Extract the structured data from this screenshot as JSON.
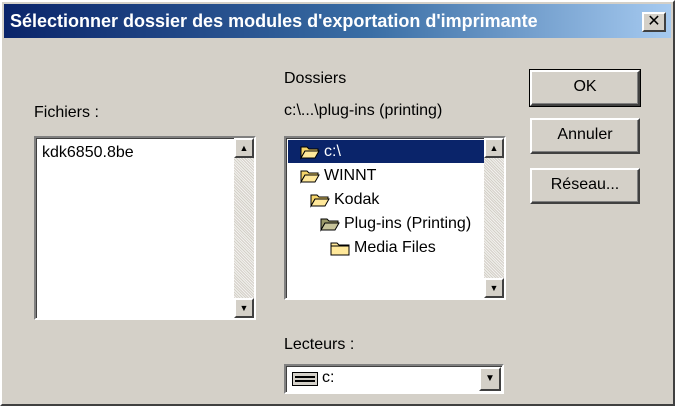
{
  "dialog": {
    "title": "Sélectionner dossier des modules d'exportation d'imprimante",
    "close_glyph": "✕"
  },
  "files": {
    "label": "Fichiers :",
    "items": [
      "kdk6850.8be"
    ]
  },
  "folders": {
    "label": "Dossiers",
    "current_path": "c:\\...\\plug-ins (printing)",
    "items": [
      {
        "label": "c:\\",
        "icon": "open-folder-icon",
        "selected": true
      },
      {
        "label": "WINNT",
        "icon": "open-folder-icon",
        "selected": false
      },
      {
        "label": "Kodak",
        "icon": "open-folder-icon",
        "selected": false
      },
      {
        "label": "Plug-ins (Printing)",
        "icon": "open-folder-icon",
        "selected": false
      },
      {
        "label": "Media Files",
        "icon": "closed-folder-icon",
        "selected": false
      }
    ]
  },
  "drives": {
    "label": "Lecteurs :",
    "value": "c:",
    "icon": "drive-icon"
  },
  "buttons": {
    "ok": "OK",
    "cancel": "Annuler",
    "network": "Réseau..."
  },
  "scroll": {
    "up_glyph": "▲",
    "down_glyph": "▼"
  },
  "colors": {
    "title_start": "#0a246a",
    "title_end": "#a6caf0",
    "selection": "#0a246a",
    "face": "#d4d0c8"
  }
}
